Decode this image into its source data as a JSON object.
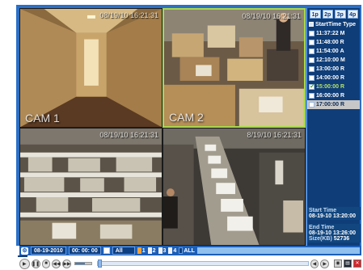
{
  "cameras": [
    {
      "id": "cam1",
      "label": "CAM 1",
      "timestamp": "08/19/10 16:21:31"
    },
    {
      "id": "cam2",
      "label": "CAM 2",
      "timestamp": "08/19/10 16:21:31"
    },
    {
      "id": "cam3",
      "label": "",
      "timestamp": "08/19/10 16:21:31"
    },
    {
      "id": "cam4",
      "label": "",
      "timestamp": "8/19/10 16:21:31"
    }
  ],
  "layouts": [
    "1p",
    "2p",
    "3p",
    "4p"
  ],
  "list_header": {
    "start_time": "StartTime",
    "type": "Type"
  },
  "records": [
    {
      "time": "11:37:22",
      "type": "M"
    },
    {
      "time": "11:48:00",
      "type": "R"
    },
    {
      "time": "11:54:00",
      "type": "A"
    },
    {
      "time": "12:10:00",
      "type": "M"
    },
    {
      "time": "13:00:00",
      "type": "R"
    },
    {
      "time": "14:00:00",
      "type": "R"
    },
    {
      "time": "15:00:00",
      "type": "R"
    },
    {
      "time": "16:00:00",
      "type": "R"
    },
    {
      "time": "17:00:00",
      "type": "R"
    }
  ],
  "info": {
    "start_label": "Start Time",
    "start_value": "08-19-10 13:20:00",
    "end_label": "End Time",
    "end_value": "08-19-10 13:26:00",
    "size_label": "Size(KB)",
    "size_value": "52736"
  },
  "control_bar": {
    "date": "08-19-2010",
    "time": "00: 00: 00",
    "all_label": "All",
    "channels": [
      "1",
      "2",
      "3",
      "4"
    ],
    "all_channels_label": "ALL"
  },
  "colors": {
    "frame_blue": "#2c6fc7",
    "panel_blue": "#0f3d78",
    "selected_border": "#a8d84c",
    "playing_text": "#b6e36a"
  }
}
